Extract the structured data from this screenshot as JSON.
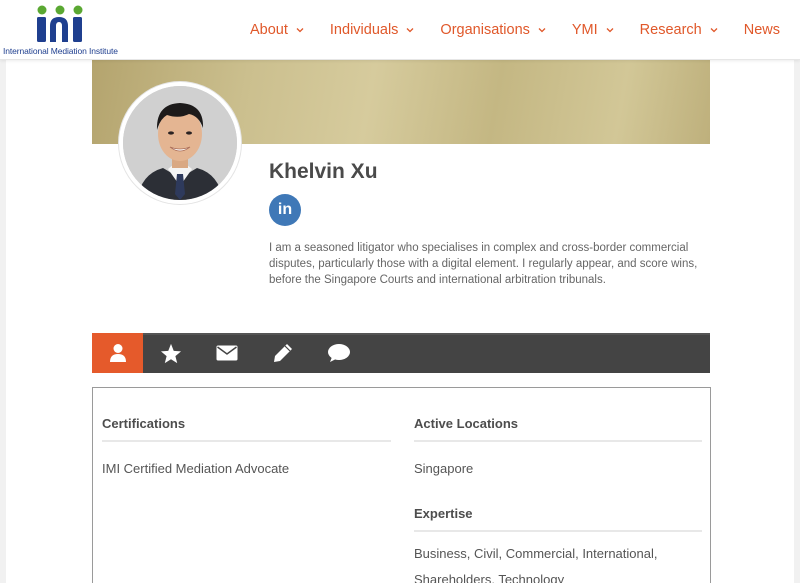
{
  "header": {
    "logo_text": "International Mediation Institute",
    "nav": [
      {
        "label": "About",
        "has_dropdown": true
      },
      {
        "label": "Individuals",
        "has_dropdown": true
      },
      {
        "label": "Organisations",
        "has_dropdown": true
      },
      {
        "label": "YMI",
        "has_dropdown": true
      },
      {
        "label": "Research",
        "has_dropdown": true
      },
      {
        "label": "News",
        "has_dropdown": false
      }
    ]
  },
  "profile": {
    "name": "Khelvin Xu",
    "linkedin_label": "in",
    "bio": "I am a seasoned litigator who specialises in complex and cross-border commercial disputes, particularly those with a digital element. I regularly appear, and score wins, before the Singapore Courts and international arbitration tribunals."
  },
  "tabs": [
    {
      "icon": "user-icon",
      "active": true
    },
    {
      "icon": "star-icon",
      "active": false
    },
    {
      "icon": "envelope-icon",
      "active": false
    },
    {
      "icon": "pencil-icon",
      "active": false
    },
    {
      "icon": "chat-bubble-icon",
      "active": false
    }
  ],
  "details": {
    "certifications_title": "Certifications",
    "certifications_value": "IMI Certified Mediation Advocate",
    "locations_title": "Active Locations",
    "locations_value": "Singapore",
    "expertise_title": "Expertise",
    "expertise_value": "Business, Civil, Commercial, International, Shareholders, Technology"
  },
  "colors": {
    "accent": "#e0582a",
    "tab_active": "#e55a2b",
    "tabbar": "#444444",
    "logo_blue": "#1f3f8f",
    "logo_green": "#5aa832",
    "linkedin": "#3f78b7"
  }
}
